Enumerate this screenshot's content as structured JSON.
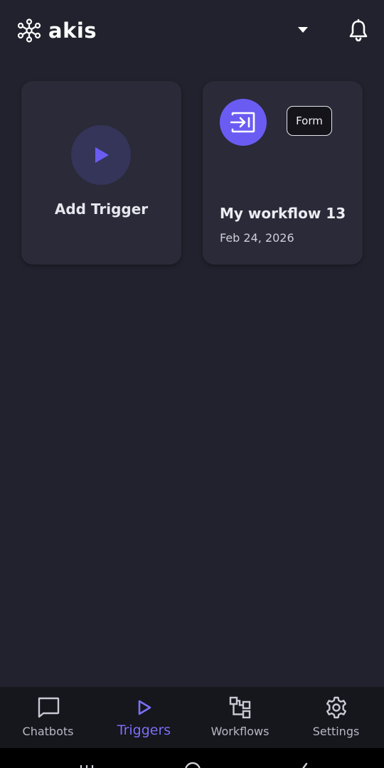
{
  "app": {
    "name": "akis"
  },
  "header": {
    "logo_icon": "network-nodes-icon",
    "dropdown_icon": "caret-down-icon",
    "notifications_icon": "bell-icon"
  },
  "cards": {
    "add_trigger": {
      "label": "Add Trigger",
      "icon": "play-icon"
    },
    "workflow": {
      "icon": "form-enter-icon",
      "badge": "Form",
      "title": "My workflow 13",
      "date": "Feb 24, 2026"
    }
  },
  "bottom_nav": {
    "items": [
      {
        "label": "Chatbots",
        "icon": "chat-bubble-icon",
        "active": false
      },
      {
        "label": "Triggers",
        "icon": "play-outline-icon",
        "active": true
      },
      {
        "label": "Workflows",
        "icon": "workflow-nodes-icon",
        "active": false
      },
      {
        "label": "Settings",
        "icon": "gear-icon",
        "active": false
      }
    ]
  },
  "colors": {
    "background": "#22222e",
    "card": "#2a2a38",
    "accent": "#6a5cf2",
    "active_nav": "#7b6ff5",
    "nav_background": "#16161d"
  }
}
